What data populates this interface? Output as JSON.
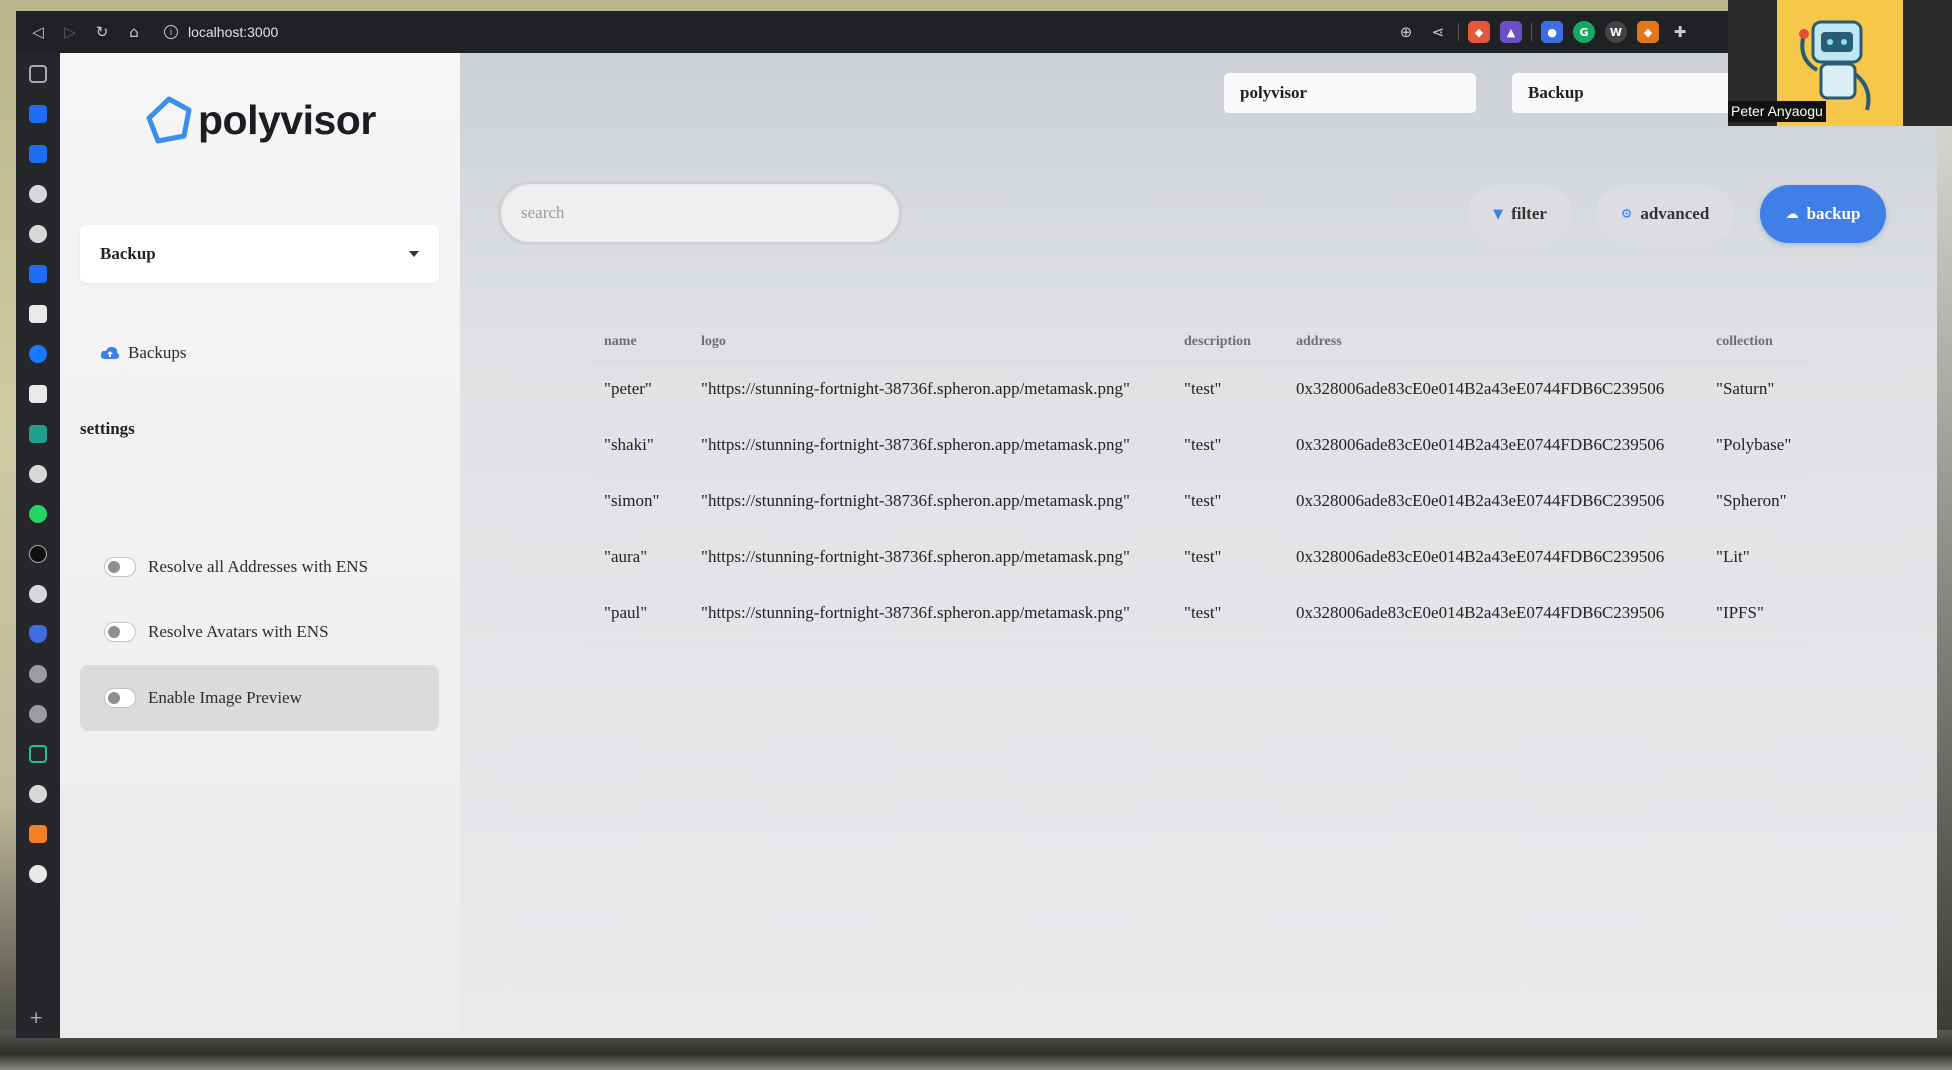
{
  "browser": {
    "url": "localhost:3000"
  },
  "app": {
    "logo_text": "polyvisor",
    "section_select": "Backup",
    "nav": [
      {
        "label": "Backups"
      }
    ],
    "settings_title": "settings",
    "settings": [
      {
        "label": "Resolve all Addresses with ENS",
        "enabled": false
      },
      {
        "label": "Resolve Avatars with ENS",
        "enabled": false
      },
      {
        "label": "Enable Image Preview",
        "enabled": false
      }
    ]
  },
  "header": {
    "selects": [
      "polyvisor",
      "Backup"
    ]
  },
  "search": {
    "placeholder": "search"
  },
  "actions": {
    "filter": "filter",
    "advanced": "advanced",
    "backup": "backup"
  },
  "table": {
    "columns": [
      "name",
      "logo",
      "description",
      "address",
      "collection"
    ],
    "rows": [
      [
        "\"peter\"",
        "\"https://stunning-fortnight-38736f.spheron.app/metamask.png\"",
        "\"test\"",
        "0x328006ade83cE0e014B2a43eE0744FDB6C239506",
        "\"Saturn\""
      ],
      [
        "\"shaki\"",
        "\"https://stunning-fortnight-38736f.spheron.app/metamask.png\"",
        "\"test\"",
        "0x328006ade83cE0e014B2a43eE0744FDB6C239506",
        "\"Polybase\""
      ],
      [
        "\"simon\"",
        "\"https://stunning-fortnight-38736f.spheron.app/metamask.png\"",
        "\"test\"",
        "0x328006ade83cE0e014B2a43eE0744FDB6C239506",
        "\"Spheron\""
      ],
      [
        "\"aura\"",
        "\"https://stunning-fortnight-38736f.spheron.app/metamask.png\"",
        "\"test\"",
        "0x328006ade83cE0e014B2a43eE0744FDB6C239506",
        "\"Lit\""
      ],
      [
        "\"paul\"",
        "\"https://stunning-fortnight-38736f.spheron.app/metamask.png\"",
        "\"test\"",
        "0x328006ade83cE0e014B2a43eE0744FDB6C239506",
        "\"IPFS\""
      ]
    ]
  },
  "webcam": {
    "name": "Peter Anyaogu"
  },
  "colors": {
    "accent": "#3f7fe6",
    "logo_blue": "#3b8fe8"
  }
}
